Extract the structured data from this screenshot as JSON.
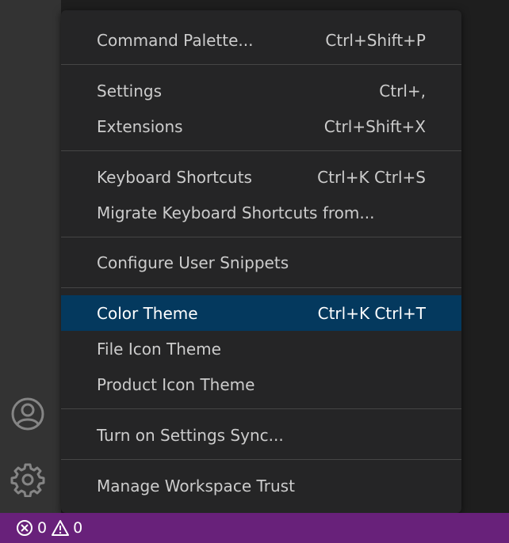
{
  "menu": {
    "items": [
      {
        "label": "Command Palette...",
        "shortcut": "Ctrl+Shift+P"
      },
      {
        "label": "Settings",
        "shortcut": "Ctrl+,"
      },
      {
        "label": "Extensions",
        "shortcut": "Ctrl+Shift+X"
      },
      {
        "label": "Keyboard Shortcuts",
        "shortcut": "Ctrl+K Ctrl+S"
      },
      {
        "label": "Migrate Keyboard Shortcuts from...",
        "shortcut": ""
      },
      {
        "label": "Configure User Snippets",
        "shortcut": ""
      },
      {
        "label": "Color Theme",
        "shortcut": "Ctrl+K Ctrl+T"
      },
      {
        "label": "File Icon Theme",
        "shortcut": ""
      },
      {
        "label": "Product Icon Theme",
        "shortcut": ""
      },
      {
        "label": "Turn on Settings Sync...",
        "shortcut": ""
      },
      {
        "label": "Manage Workspace Trust",
        "shortcut": ""
      }
    ]
  },
  "activity_bar": {
    "icons": [
      "account-icon",
      "manage-gear-icon"
    ]
  },
  "status_bar": {
    "errors": "0",
    "warnings": "0"
  },
  "colors": {
    "status_bar_bg": "#68217a",
    "menu_bg": "#252526",
    "selected_bg": "#04395e",
    "activity_bar_bg": "#333333"
  }
}
